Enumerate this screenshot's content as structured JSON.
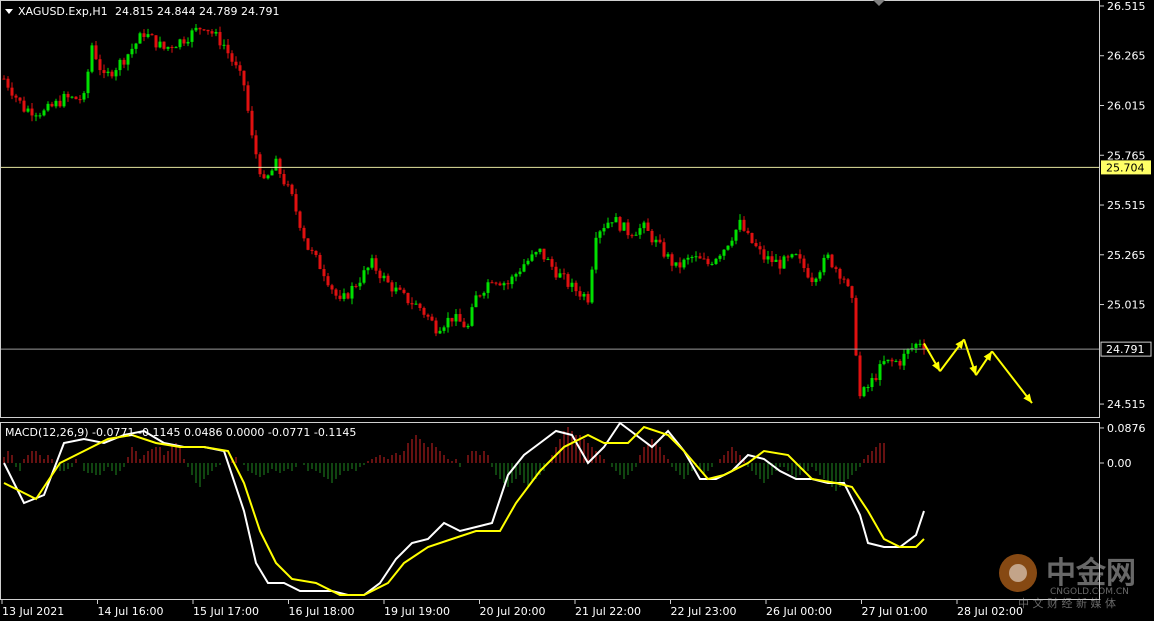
{
  "header": {
    "symbol": "XAGUSD.Exp,H1",
    "ohlc": "24.815 24.844 24.789 24.791"
  },
  "macd_header": {
    "label": "MACD(12,26,9) -0.0771 -0.1145 0.0486 0.0000 -0.0771 -0.1145"
  },
  "colors": {
    "background": "#000000",
    "bull_candle": "#00e000",
    "bear_candle": "#e01010",
    "macd_line": "#ffffff",
    "signal_line": "#ffff00",
    "hist_up": "#cc2222",
    "hist_down": "#1f8a1f",
    "hline": "#ffffbb",
    "arrow": "#ffff00"
  },
  "watermark": {
    "cn": "中金网",
    "site": "CNGOLD.COM.CN",
    "tag": "中 文 财 经 新 媒 体"
  },
  "chart_data": [
    {
      "type": "candlestick",
      "title": "XAGUSD.Exp,H1",
      "price_ticks": [
        "26.515",
        "26.265",
        "26.015",
        "25.765",
        "25.515",
        "25.265",
        "25.015",
        "24.515"
      ],
      "ylim": [
        24.45,
        26.54
      ],
      "hlines": [
        {
          "price": 25.704,
          "label": "25.704",
          "label_style": "highlight"
        },
        {
          "price": 24.791,
          "label": "24.791",
          "label_style": "boxed"
        }
      ],
      "x_labels": [
        "13 Jul 2021",
        "14 Jul 16:00",
        "15 Jul 17:00",
        "16 Jul 18:00",
        "19 Jul 19:00",
        "20 Jul 20:00",
        "21 Jul 22:00",
        "22 Jul 23:00",
        "26 Jul 00:00",
        "27 Jul 01:00",
        "28 Jul 02:00"
      ],
      "price_path": [
        [
          0,
          26.15
        ],
        [
          5,
          26.0
        ],
        [
          10,
          25.98
        ],
        [
          15,
          26.05
        ],
        [
          20,
          26.05
        ],
        [
          22,
          26.32
        ],
        [
          25,
          26.15
        ],
        [
          30,
          26.25
        ],
        [
          35,
          26.38
        ],
        [
          40,
          26.3
        ],
        [
          45,
          26.35
        ],
        [
          50,
          26.42
        ],
        [
          55,
          26.32
        ],
        [
          60,
          26.12
        ],
        [
          62,
          25.85
        ],
        [
          65,
          25.62
        ],
        [
          68,
          25.72
        ],
        [
          72,
          25.55
        ],
        [
          76,
          25.3
        ],
        [
          80,
          25.18
        ],
        [
          84,
          25.02
        ],
        [
          88,
          25.12
        ],
        [
          92,
          25.22
        ],
        [
          96,
          25.12
        ],
        [
          100,
          25.05
        ],
        [
          104,
          25.0
        ],
        [
          108,
          24.9
        ],
        [
          112,
          24.95
        ],
        [
          116,
          24.9
        ],
        [
          118,
          25.05
        ],
        [
          122,
          25.15
        ],
        [
          126,
          25.12
        ],
        [
          130,
          25.22
        ],
        [
          134,
          25.28
        ],
        [
          138,
          25.18
        ],
        [
          142,
          25.1
        ],
        [
          146,
          25.05
        ],
        [
          148,
          25.38
        ],
        [
          152,
          25.45
        ],
        [
          156,
          25.38
        ],
        [
          160,
          25.4
        ],
        [
          164,
          25.3
        ],
        [
          168,
          25.2
        ],
        [
          172,
          25.25
        ],
        [
          176,
          25.22
        ],
        [
          180,
          25.3
        ],
        [
          184,
          25.42
        ],
        [
          186,
          25.35
        ],
        [
          190,
          25.25
        ],
        [
          194,
          25.22
        ],
        [
          198,
          25.25
        ],
        [
          202,
          25.15
        ],
        [
          206,
          25.25
        ],
        [
          210,
          25.15
        ],
        [
          212,
          25.02
        ],
        [
          214,
          24.55
        ],
        [
          216,
          24.6
        ],
        [
          220,
          24.72
        ],
        [
          224,
          24.73
        ],
        [
          226,
          24.78
        ],
        [
          229,
          24.83
        ],
        [
          230,
          24.79
        ]
      ],
      "forecast_arrows": [
        {
          "from": [
            230,
            24.82
          ],
          "to": [
            234,
            24.68
          ]
        },
        {
          "from": [
            234,
            24.68
          ],
          "to": [
            240,
            24.84
          ]
        },
        {
          "from": [
            240,
            24.84
          ],
          "to": [
            243,
            24.66
          ]
        },
        {
          "from": [
            243,
            24.66
          ],
          "to": [
            247,
            24.78
          ]
        },
        {
          "from": [
            247,
            24.78
          ],
          "to": [
            257,
            24.52
          ]
        }
      ]
    },
    {
      "type": "line",
      "title": "MACD(12,26,9)",
      "y_ticks": [
        "0.0876",
        "0.00"
      ],
      "ylim": [
        -0.34,
        0.1
      ],
      "series": [
        {
          "values": [
            [
              0,
              -0.0
            ],
            [
              5,
              -0.1
            ],
            [
              10,
              -0.08
            ],
            [
              15,
              0.05
            ],
            [
              20,
              0.06
            ],
            [
              25,
              0.05
            ],
            [
              30,
              0.07
            ],
            [
              35,
              0.08
            ],
            [
              40,
              0.05
            ],
            [
              45,
              0.04
            ],
            [
              50,
              0.04
            ],
            [
              55,
              0.03
            ],
            [
              60,
              -0.12
            ],
            [
              63,
              -0.25
            ],
            [
              66,
              -0.3
            ],
            [
              70,
              -0.3
            ],
            [
              74,
              -0.32
            ],
            [
              78,
              -0.32
            ],
            [
              82,
              -0.32
            ],
            [
              86,
              -0.33
            ],
            [
              90,
              -0.33
            ],
            [
              94,
              -0.3
            ],
            [
              98,
              -0.24
            ],
            [
              102,
              -0.2
            ],
            [
              106,
              -0.19
            ],
            [
              110,
              -0.15
            ],
            [
              114,
              -0.17
            ],
            [
              118,
              -0.16
            ],
            [
              122,
              -0.15
            ],
            [
              126,
              -0.03
            ],
            [
              130,
              0.02
            ],
            [
              134,
              0.05
            ],
            [
              138,
              0.08
            ],
            [
              142,
              0.07
            ],
            [
              146,
              0.0
            ],
            [
              150,
              0.04
            ],
            [
              154,
              0.1
            ],
            [
              158,
              0.07
            ],
            [
              162,
              0.04
            ],
            [
              166,
              0.08
            ],
            [
              170,
              0.03
            ],
            [
              174,
              -0.04
            ],
            [
              178,
              -0.04
            ],
            [
              182,
              -0.02
            ],
            [
              186,
              0.02
            ],
            [
              190,
              0.01
            ],
            [
              194,
              -0.02
            ],
            [
              198,
              -0.04
            ],
            [
              202,
              -0.04
            ],
            [
              206,
              -0.05
            ],
            [
              210,
              -0.05
            ],
            [
              214,
              -0.13
            ],
            [
              216,
              -0.2
            ],
            [
              220,
              -0.21
            ],
            [
              224,
              -0.21
            ],
            [
              228,
              -0.18
            ],
            [
              230,
              -0.12
            ]
          ]
        },
        {
          "values": [
            [
              0,
              -0.05
            ],
            [
              8,
              -0.09
            ],
            [
              14,
              0.0
            ],
            [
              20,
              0.03
            ],
            [
              26,
              0.06
            ],
            [
              32,
              0.07
            ],
            [
              38,
              0.05
            ],
            [
              44,
              0.04
            ],
            [
              50,
              0.04
            ],
            [
              56,
              0.03
            ],
            [
              60,
              -0.05
            ],
            [
              64,
              -0.17
            ],
            [
              68,
              -0.25
            ],
            [
              72,
              -0.29
            ],
            [
              78,
              -0.3
            ],
            [
              84,
              -0.33
            ],
            [
              90,
              -0.33
            ],
            [
              96,
              -0.3
            ],
            [
              100,
              -0.25
            ],
            [
              106,
              -0.21
            ],
            [
              112,
              -0.19
            ],
            [
              118,
              -0.17
            ],
            [
              124,
              -0.17
            ],
            [
              128,
              -0.1
            ],
            [
              134,
              -0.02
            ],
            [
              140,
              0.04
            ],
            [
              146,
              0.07
            ],
            [
              150,
              0.05
            ],
            [
              156,
              0.05
            ],
            [
              160,
              0.09
            ],
            [
              166,
              0.07
            ],
            [
              170,
              0.03
            ],
            [
              176,
              -0.04
            ],
            [
              180,
              -0.03
            ],
            [
              186,
              -0.0
            ],
            [
              190,
              0.03
            ],
            [
              196,
              0.02
            ],
            [
              202,
              -0.04
            ],
            [
              208,
              -0.05
            ],
            [
              212,
              -0.06
            ],
            [
              216,
              -0.12
            ],
            [
              220,
              -0.19
            ],
            [
              224,
              -0.21
            ],
            [
              228,
              -0.21
            ],
            [
              230,
              -0.19
            ]
          ]
        }
      ],
      "histogram": [
        0.015,
        0.03,
        0.02,
        -0.01,
        -0.02,
        0.01,
        0.02,
        0.03,
        0.03,
        0.02,
        0.01,
        0.02,
        0.01,
        -0.01,
        -0.02,
        -0.02,
        -0.015,
        -0.01,
        0.01,
        0.0,
        -0.02,
        -0.025,
        -0.025,
        -0.03,
        -0.03,
        -0.02,
        -0.01,
        -0.02,
        -0.03,
        -0.02,
        -0.01,
        0.015,
        0.04,
        0.03,
        0.01,
        0.02,
        0.03,
        0.035,
        0.04,
        0.04,
        0.02,
        0.03,
        0.045,
        0.05,
        0.04,
        0.01,
        -0.01,
        -0.03,
        -0.05,
        -0.06,
        -0.04,
        -0.03,
        -0.02,
        -0.01,
        -0.005,
        0.0,
        0.005,
        0.01,
        0.015,
        0.0,
        -0.005,
        -0.02,
        -0.025,
        -0.03,
        -0.035,
        -0.03,
        -0.025,
        -0.015,
        -0.02,
        -0.025,
        -0.02,
        -0.015,
        -0.02,
        -0.01,
        0.0,
        -0.005,
        -0.02,
        -0.015,
        -0.02,
        -0.025,
        -0.035,
        -0.04,
        -0.05,
        -0.04,
        -0.03,
        -0.02,
        -0.02,
        -0.015,
        -0.02,
        -0.01,
        -0.005,
        0.005,
        0.01,
        0.015,
        0.02,
        0.015,
        0.01,
        0.02,
        0.025,
        0.02,
        0.03,
        0.05,
        0.06,
        0.07,
        0.06,
        0.05,
        0.04,
        0.05,
        0.04,
        0.03,
        0.02,
        0.01,
        0.005,
        0.01,
        -0.01,
        0.0,
        0.02,
        0.03,
        0.03,
        0.02,
        0.03,
        0.02,
        -0.01,
        -0.03,
        -0.04,
        -0.05,
        -0.06,
        -0.05,
        -0.04,
        -0.03,
        -0.05,
        -0.06,
        -0.05,
        -0.04,
        -0.03,
        -0.02,
        0.0,
        0.02,
        0.04,
        0.06,
        0.08,
        0.09,
        0.08,
        0.07,
        0.07,
        0.06,
        0.05,
        0.04,
        0.03,
        0.02,
        0.01,
        0.0,
        -0.01,
        -0.02,
        -0.03,
        -0.04,
        -0.03,
        -0.02,
        -0.01,
        0.02,
        0.04,
        0.05,
        0.06,
        0.05,
        0.04,
        0.02,
        0.01,
        -0.01,
        -0.02,
        -0.03,
        -0.04,
        -0.03,
        -0.02,
        -0.01,
        -0.02,
        -0.03,
        -0.02,
        -0.01,
        0.0,
        0.01,
        0.02,
        0.03,
        0.04,
        0.03,
        0.02,
        0.01,
        -0.01,
        -0.02,
        -0.03,
        -0.04,
        -0.05,
        -0.04,
        -0.03,
        -0.02,
        -0.01,
        -0.01,
        -0.02,
        -0.03,
        -0.04,
        -0.03,
        -0.02,
        -0.02,
        -0.01,
        -0.02,
        -0.03,
        -0.04,
        -0.05,
        -0.06,
        -0.07,
        -0.06,
        -0.05,
        -0.04,
        -0.03,
        -0.02,
        -0.01,
        0.01,
        0.02,
        0.03,
        0.04,
        0.05,
        0.05
      ]
    }
  ]
}
